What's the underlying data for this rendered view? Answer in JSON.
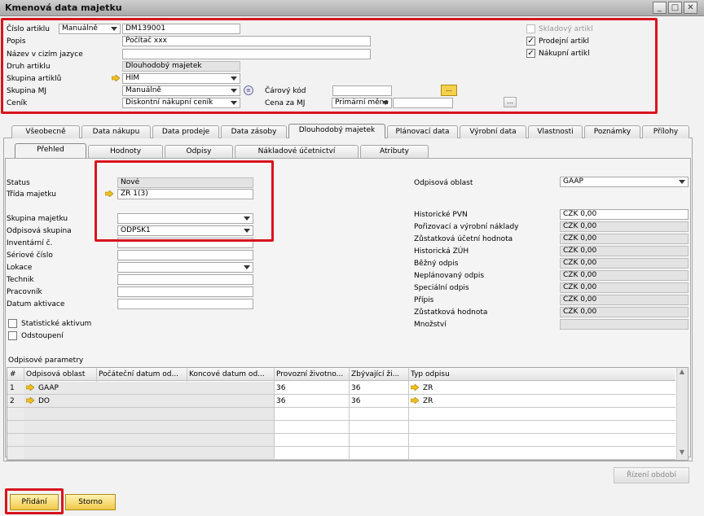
{
  "window": {
    "title": "Kmenová data majetku"
  },
  "header": {
    "item_no_label": "Číslo artiklu",
    "series": "Manuálně",
    "item_no": "DM139001",
    "desc_label": "Popis",
    "desc": "Počítač xxx",
    "foreign_label": "Název v cizím jazyce",
    "type_label": "Druh artiklu",
    "type": "Dlouhodobý majetek",
    "group_label": "Skupina artiklů",
    "group": "HIM",
    "uom_label": "Skupina MJ",
    "uom": "Manuálně",
    "barcode_label": "Čárový kód",
    "barcode_btn": "...",
    "price_list_label": "Ceník",
    "price_list": "Diskontní nákupní ceník",
    "unit_price_label": "Cena za MJ",
    "unit_price_curr": "Primární měna",
    "browse_btn": "...",
    "inventory_item": "Skladový artikl",
    "sales_item": "Prodejní artikl",
    "purchase_item": "Nákupní artikl"
  },
  "tabs": [
    "Všeobecně",
    "Data nákupu",
    "Data prodeje",
    "Data zásoby",
    "Dlouhodobý majetek",
    "Plánovací data",
    "Výrobní data",
    "Vlastnosti",
    "Poznámky",
    "Přílohy"
  ],
  "subtabs": [
    "Přehled",
    "Hodnoty",
    "Odpisy",
    "Nákladové účetnictví",
    "Atributy"
  ],
  "left": {
    "status_label": "Status",
    "status": "Nové",
    "class_label": "Třída majetku",
    "class": "ZR 1(3)",
    "asset_group_label": "Skupina majetku",
    "asset_group": "",
    "depr_group_label": "Odpisová skupina",
    "depr_group": "ODPSK1",
    "inventory_no_label": "Inventární č.",
    "serial_label": "Sériové číslo",
    "location_label": "Lokace",
    "technician_label": "Technik",
    "employee_label": "Pracovník",
    "cap_date_label": "Datum aktivace",
    "statistical": "Statistické aktivum",
    "retired": "Odstoupení"
  },
  "right": {
    "area_label": "Odpisová oblast",
    "area": "GAAP",
    "rows": [
      {
        "label": "Historické PVN",
        "value": "CZK 0,00"
      },
      {
        "label": "Pořizovací a výrobní náklady",
        "value": "CZK 0,00"
      },
      {
        "label": "Zůstatková účetní hodnota",
        "value": "CZK 0,00"
      },
      {
        "label": "Historická ZÚH",
        "value": "CZK 0,00"
      },
      {
        "label": "Běžný odpis",
        "value": "CZK 0,00"
      },
      {
        "label": "Neplánovaný odpis",
        "value": "CZK 0,00"
      },
      {
        "label": "Speciální odpis",
        "value": "CZK 0,00"
      },
      {
        "label": "Přípis",
        "value": "CZK 0,00"
      },
      {
        "label": "Zůstatková hodnota",
        "value": "CZK 0,00"
      },
      {
        "label": "Množství",
        "value": ""
      }
    ]
  },
  "params": {
    "title": "Odpisové parametry",
    "columns": [
      "#",
      "Odpisová oblast",
      "Počáteční datum od...",
      "Koncové datum od...",
      "Provozní životno...",
      "Zbývající ži...",
      "Typ odpisu"
    ],
    "rows": [
      {
        "n": "1",
        "area": "GAAP",
        "start": "",
        "end": "",
        "life": "36",
        "remain": "36",
        "type": "ZR"
      },
      {
        "n": "2",
        "area": "DO",
        "start": "",
        "end": "",
        "life": "36",
        "remain": "36",
        "type": "ZR"
      }
    ]
  },
  "buttons": {
    "period_control": "Řízení období",
    "add": "Přidání",
    "cancel": "Storno"
  }
}
